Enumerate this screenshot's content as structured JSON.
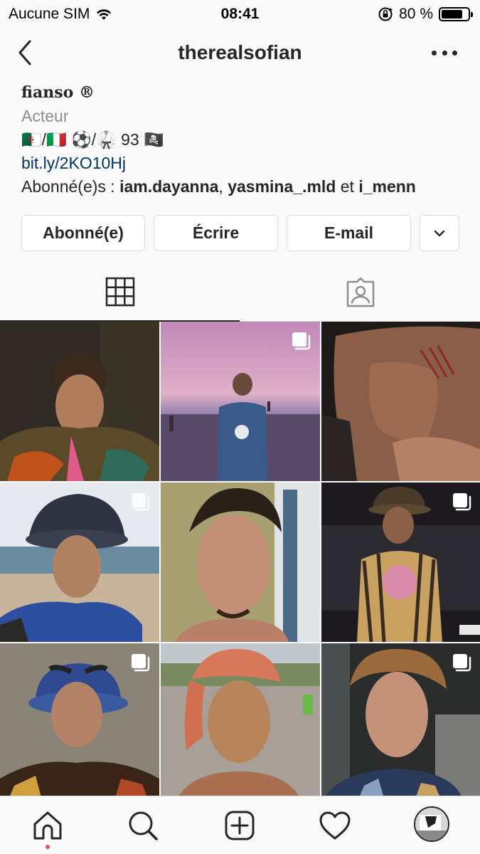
{
  "status_bar": {
    "carrier": "Aucune SIM",
    "time": "08:41",
    "battery_percent": "80 %",
    "battery_level": 0.8
  },
  "header": {
    "username": "therealsofian",
    "back_icon": "chevron-left-icon",
    "more_icon": "more-horizontal-icon"
  },
  "bio": {
    "display_name": "fianso ®",
    "category": "Acteur",
    "flags_line": "🇩🇿/🇮🇹 ⚽/🥋 93 🏴‍☠️",
    "link": "bit.ly/2KO10Hj",
    "followed_by_prefix": "Abonné(e)s : ",
    "followed_by_1": "iam.dayanna",
    "followed_by_sep": ", ",
    "followed_by_2": "yasmina_.mld",
    "followed_by_and": " et ",
    "followed_by_3": "i_menn"
  },
  "actions": {
    "following_label": "Abonné(e)",
    "message_label": "Écrire",
    "email_label": "E-mail",
    "dropdown_icon": "chevron-down-icon"
  },
  "tabs": [
    {
      "icon": "grid-icon",
      "active": true
    },
    {
      "icon": "tagged-icon",
      "active": false
    }
  ],
  "posts": [
    {
      "multi": false
    },
    {
      "multi": true
    },
    {
      "multi": false
    },
    {
      "multi": true
    },
    {
      "multi": false
    },
    {
      "multi": true
    },
    {
      "multi": true
    },
    {
      "multi": false
    },
    {
      "multi": true
    }
  ],
  "bottom_nav": [
    {
      "icon": "home-icon",
      "active": true
    },
    {
      "icon": "search-icon",
      "active": false
    },
    {
      "icon": "add-post-icon",
      "active": false
    },
    {
      "icon": "heart-icon",
      "active": false
    },
    {
      "icon": "profile-avatar",
      "active": false
    }
  ],
  "colors": {
    "text": "#262626",
    "muted": "#8e8e8e",
    "link": "#003569",
    "border": "#dbdbdb",
    "background": "#fafafa",
    "notification_dot": "#ed4956"
  }
}
